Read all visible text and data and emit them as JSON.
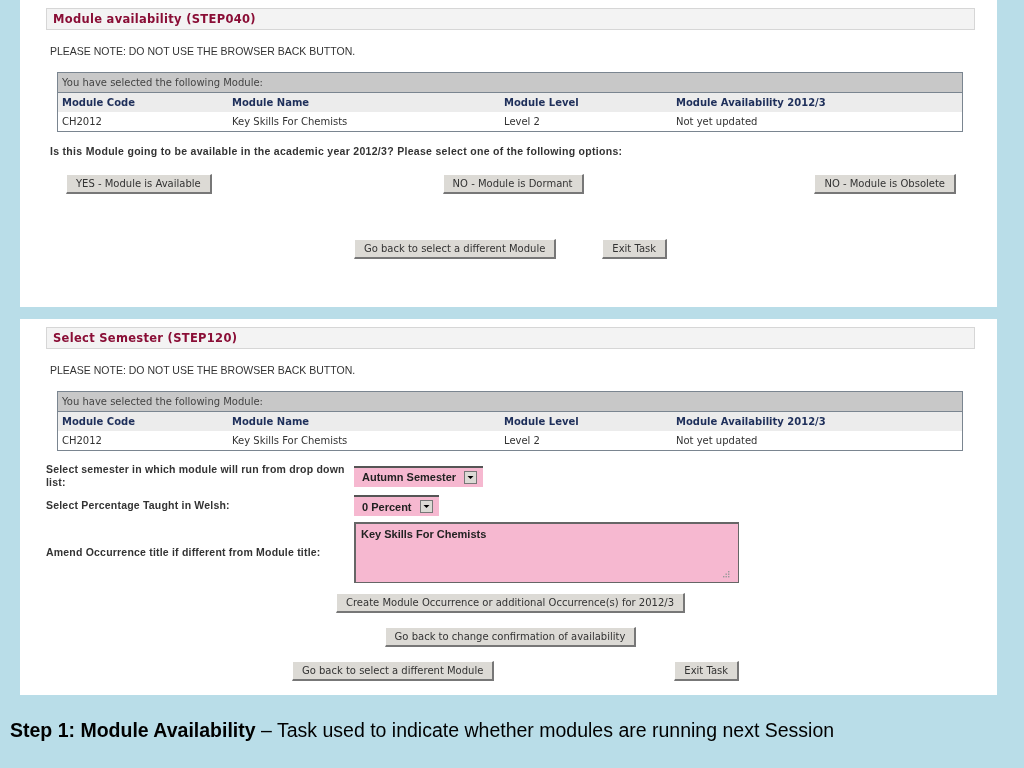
{
  "panels": [
    {
      "title": "Module availability (STEP040)",
      "note": "PLEASE NOTE: DO NOT USE THE BROWSER BACK BUTTON.",
      "table": {
        "caption": "You have selected the following Module:",
        "columns": [
          "Module Code",
          "Module Name",
          "Module Level",
          "Module Availability 2012/3"
        ],
        "rows": [
          [
            "CH2012",
            "Key Skills For Chemists",
            "Level 2",
            "Not yet updated"
          ]
        ]
      },
      "question": "Is this Module going to be available in the academic year 2012/3? Please select one of the following options:",
      "option_buttons": [
        "YES - Module is Available",
        "NO - Module is Dormant",
        "NO - Module is Obsolete"
      ],
      "nav_buttons": [
        "Go back to select a different Module",
        "Exit Task"
      ]
    },
    {
      "title": "Select Semester (STEP120)",
      "note": "PLEASE NOTE: DO NOT USE THE BROWSER BACK BUTTON.",
      "table": {
        "caption": "You have selected the following Module:",
        "columns": [
          "Module Code",
          "Module Name",
          "Module Level",
          "Module Availability 2012/3"
        ],
        "rows": [
          [
            "CH2012",
            "Key Skills For Chemists",
            "Level 2",
            "Not yet updated"
          ]
        ]
      },
      "form": [
        {
          "kind": "select",
          "label": "Select semester in which module will run from drop down list:",
          "value": "Autumn Semester"
        },
        {
          "kind": "select",
          "label": "Select Percentage Taught in Welsh:",
          "value": "0 Percent"
        },
        {
          "kind": "textarea",
          "label": "Amend Occurrence title if different from Module title:",
          "value": "Key Skills For Chemists"
        }
      ],
      "action_buttons": [
        "Create Module Occurrence or additional Occurrence(s) for 2012/3",
        "Go back to change confirmation of availability"
      ],
      "nav_buttons": [
        "Go back to select a different Module",
        "Exit Task"
      ]
    }
  ],
  "caption": "**Step 1: Module Availability** – Task used to indicate whether modules are running next Session"
}
